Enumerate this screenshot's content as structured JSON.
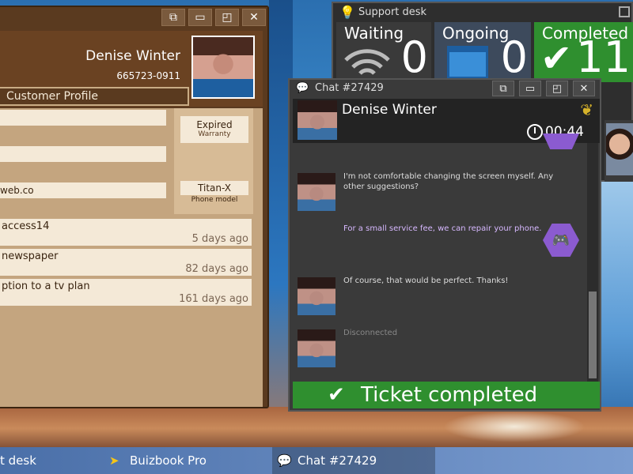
{
  "crm": {
    "customer_name": "Denise Winter",
    "customer_phone": "665723-0911",
    "section_title": "Customer Profile",
    "fields": [
      "",
      "",
      "web.co"
    ],
    "warranty_value": "Expired",
    "warranty_label": "Warranty",
    "phone_model_value": "Titan-X",
    "phone_model_label": "Phone model",
    "history": [
      {
        "title": "access14",
        "ago": "5 days ago"
      },
      {
        "title": "newspaper",
        "ago": "82 days ago"
      },
      {
        "title": "ption to a tv plan",
        "ago": "161 days ago"
      }
    ]
  },
  "support_desk": {
    "title": "Support desk",
    "stats": [
      {
        "label": "Waiting",
        "value": "0",
        "color": "#3a3a3a"
      },
      {
        "label": "Ongoing",
        "value": "0",
        "color": "#3d4a5c"
      },
      {
        "label": "Completed",
        "value": "11",
        "color": "#2f8f2f"
      }
    ]
  },
  "chat": {
    "title": "Chat #27429",
    "customer_name": "Denise Winter",
    "timer": "00:44",
    "messages": [
      {
        "from": "customer",
        "text": "I'm not comfortable changing the screen myself. Any other suggestions?"
      },
      {
        "from": "agent",
        "text": "For a small service fee, we can repair your phone."
      },
      {
        "from": "customer",
        "text": "Of course, that would be perfect. Thanks!"
      },
      {
        "from": "system",
        "text": "Disconnected"
      }
    ],
    "status_banner": "Ticket completed"
  },
  "taskbar": {
    "items": [
      "t desk",
      "Buizbook Pro",
      "Chat #27429"
    ]
  },
  "colors": {
    "crm_dark": "#5a3a1f",
    "crm_paper": "#f4e9d7",
    "completed_green": "#2f8f2f",
    "agent_purple": "#8b5bd0"
  }
}
